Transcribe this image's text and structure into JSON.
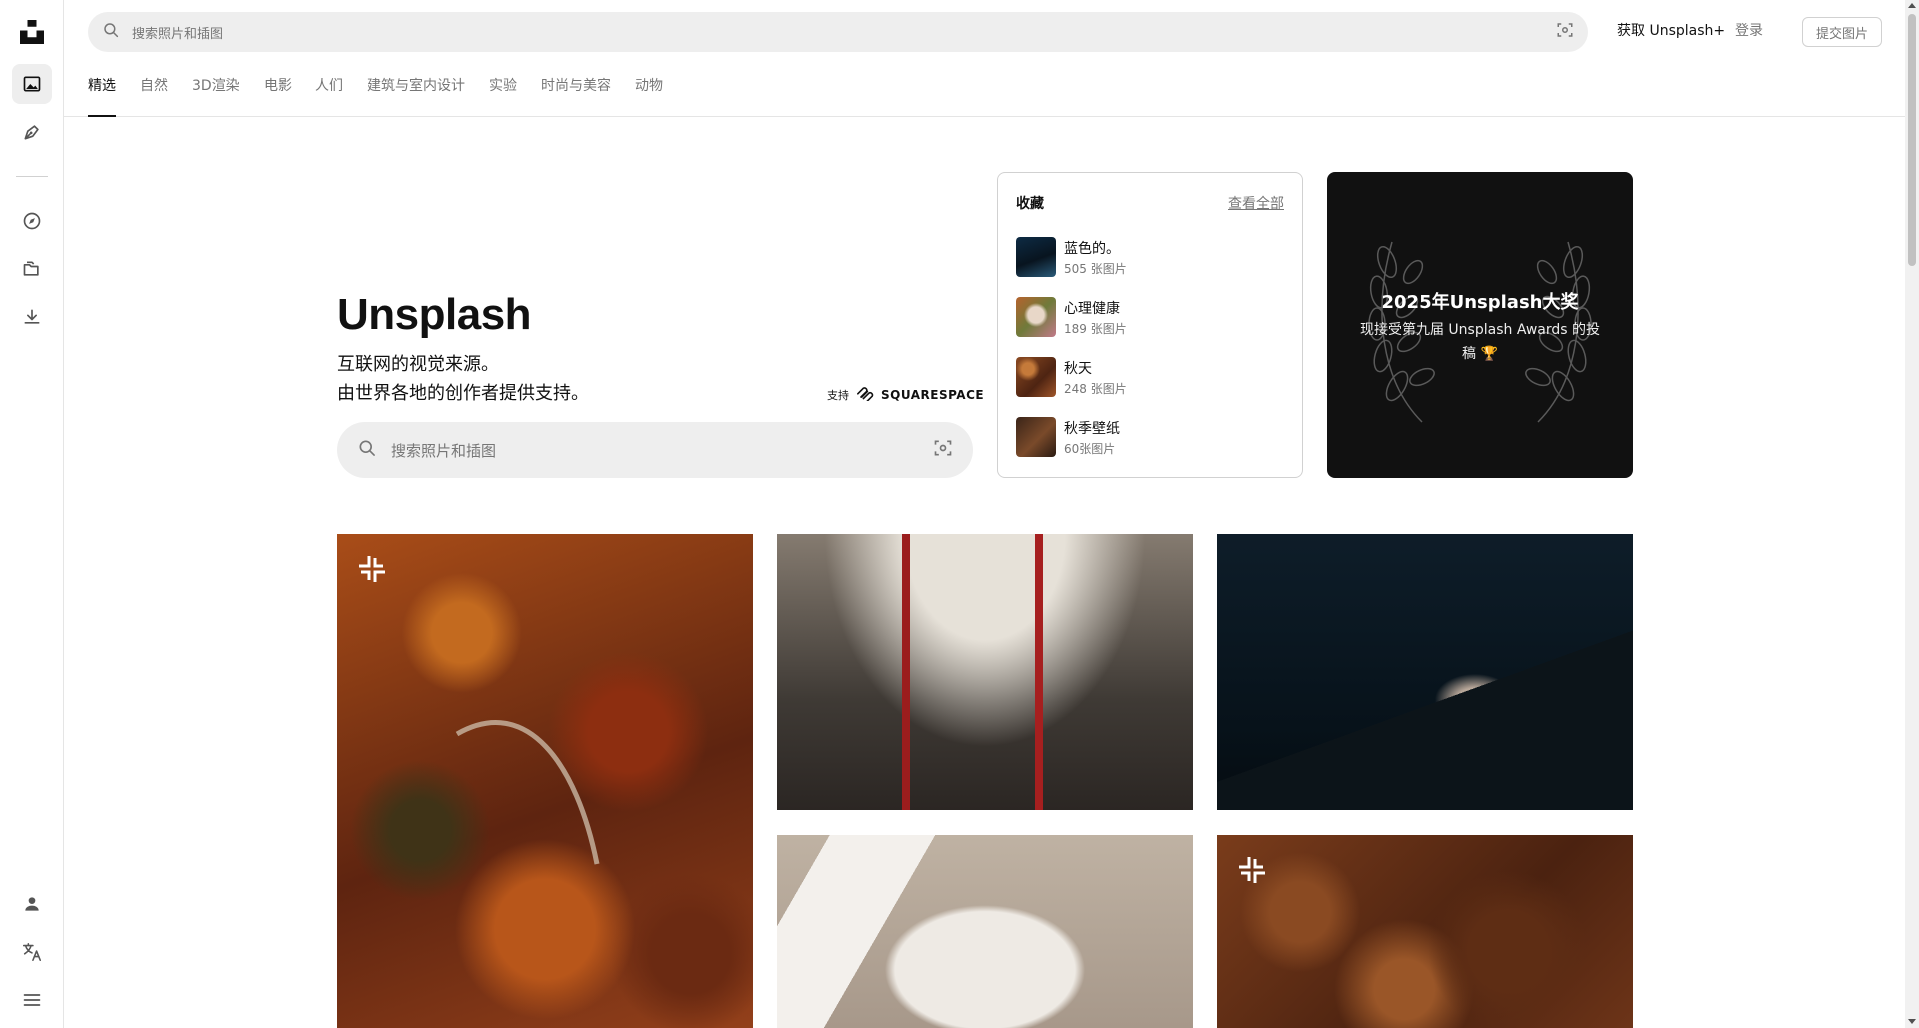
{
  "topbar": {
    "search_placeholder": "搜索照片和插图",
    "get_plus": "获取 Unsplash+",
    "login": "登录",
    "submit": "提交图片"
  },
  "tabs": [
    {
      "label": "精选",
      "active": true
    },
    {
      "label": "自然"
    },
    {
      "label": "3D渲染"
    },
    {
      "label": "电影"
    },
    {
      "label": "人们"
    },
    {
      "label": "建筑与室内设计"
    },
    {
      "label": "实验"
    },
    {
      "label": "时尚与美容"
    },
    {
      "label": "动物"
    }
  ],
  "hero": {
    "title": "Unsplash",
    "subtitle_line1": "互联网的视觉来源。",
    "subtitle_line2": "由世界各地的创作者提供支持。",
    "sponsor_label": "支持",
    "sponsor_brand": "SQUARESPACE",
    "search_placeholder": "搜索照片和插图"
  },
  "collections": {
    "title": "收藏",
    "view_all": "查看全部",
    "items": [
      {
        "name": "蓝色的。",
        "count": "505 张图片"
      },
      {
        "name": "心理健康",
        "count": "189 张图片"
      },
      {
        "name": "秋天",
        "count": "248 张图片"
      },
      {
        "name": "秋季壁纸",
        "count": "60张图片"
      }
    ]
  },
  "awards": {
    "title": "2025年Unsplash大奖",
    "subtitle": "现接受第九届 Unsplash Awards 的投稿 🏆"
  },
  "colors": {
    "accent": "#111111",
    "muted": "#767676",
    "border": "#d1d1d1",
    "search_bg": "#eeeeee"
  },
  "icons": {
    "rail": [
      "unsplash-logo-icon",
      "photos-icon",
      "illustrations-icon",
      "explore-icon",
      "collections-icon",
      "download-icon",
      "user-icon",
      "translate-icon",
      "menu-icon"
    ],
    "search": "search-icon",
    "visual_search": "visual-search-icon",
    "plus_badge": "unsplash-plus-icon"
  }
}
